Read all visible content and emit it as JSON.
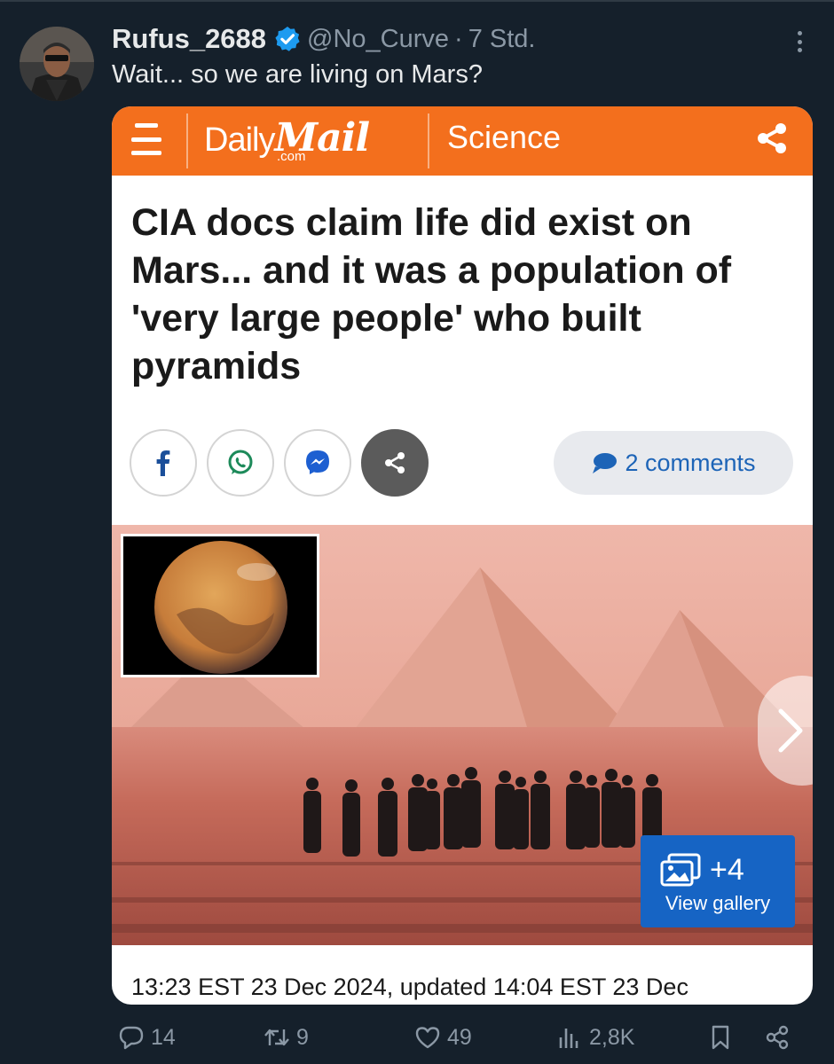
{
  "tweet": {
    "display_name": "Rufus_2688",
    "handle": "@No_Curve",
    "separator": "·",
    "time": "7 Std.",
    "text": "Wait... so we are living on Mars?",
    "verified": true
  },
  "card": {
    "brand_daily": "Daily",
    "brand_mail": "Mail",
    "brand_com": ".com",
    "section": "Science",
    "headline": "CIA docs claim life did exist on Mars... and it was a population of 'very large people' who built pyramids",
    "comments_label": "2 comments",
    "gallery_count": "+4",
    "gallery_label": "View gallery",
    "timestamp": "13:23 EST 23 Dec 2024, updated 14:04 EST 23 Dec",
    "social_icons": [
      "facebook-icon",
      "whatsapp-icon",
      "messenger-icon",
      "share-icon"
    ]
  },
  "actions": {
    "replies": "14",
    "reposts": "9",
    "likes": "49",
    "views": "2,8K"
  },
  "colors": {
    "background": "#15202b",
    "text_primary": "#e7e9ea",
    "text_secondary": "#8b98a5",
    "verified": "#1d9bf0",
    "dailymail_orange": "#f36f1d",
    "comments_blue": "#1d64b7",
    "gallery_blue": "#1664c4"
  }
}
